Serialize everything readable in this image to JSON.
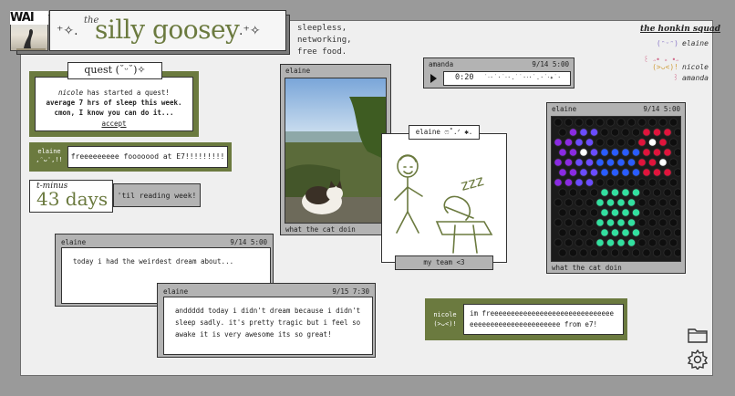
{
  "header": {
    "thumb_text": "WAI",
    "title_prefix": "the",
    "title": "silly goosey",
    "deco_left": "⁺✧.",
    "deco_right": ".⁺✧",
    "tagline": "sleepless,\nnetworking,\nfree food."
  },
  "squad": {
    "title": "the honkin squad",
    "members": [
      {
        "face": "(ᵔᵕᵔ)",
        "name": "elaine",
        "color": "#8a78c8"
      },
      {
        "face": "꒰ ˶• ༝ •˶꒱",
        "name": "amanda",
        "color": "#d06a8a"
      },
      {
        "face": "(>ᴗ<)!",
        "name": "nicole",
        "color": "#d0a040"
      }
    ]
  },
  "quest": {
    "label": "quest (˘ᵕ˘)✧",
    "user": "nicole",
    "line1": " has started a quest!",
    "line2": "average 7 hrs of sleep this week.",
    "line3": "cmon, I know you can do it...",
    "accept": "accept"
  },
  "elaine_chat": {
    "name": "elaine",
    "face": ",ᵔᴗᵔ,!!",
    "message": "freeeeeeeee fooooood at E7!!!!!!!!!"
  },
  "countdown": {
    "label": "t-minus",
    "value": "43 days",
    "side": "'til reading week!"
  },
  "post1": {
    "author": "elaine",
    "time": "9/14 5:00",
    "body": "today i had the weirdest dream about..."
  },
  "post2": {
    "author": "elaine",
    "time": "9/15 7:30",
    "body": "anddddd today i didn't dream because i didn't sleep sadly. it's pretty tragic but i feel so awake it is very awesome its so great!"
  },
  "photo1": {
    "author": "elaine",
    "caption": "what the cat doin"
  },
  "audio": {
    "author": "amanda",
    "time": "9/14 5:00",
    "duration": "0:20",
    "wave": "˙‧·˙·˙‧·.˙˙·‧·˙.·˙‧✦˙·"
  },
  "drawing": {
    "label": "elaine ෆ˚.ᐟ ✱.",
    "caption": "my team <3",
    "zzz": "zzz"
  },
  "photo2": {
    "author": "elaine",
    "time": "9/14 5:00",
    "caption": "what the cat doin"
  },
  "nicole_chat": {
    "name": "nicole",
    "face": "(>ᴗ<)!",
    "message": "im freeeeeeeeeeeeeeeeeeeeeeeeeeeeeeeeeeeeeeeeeeeeeeeeeeee from e7!"
  },
  "colors": {
    "green": "#6b7a3f",
    "grey": "#b3b3b3",
    "board": "#efefef"
  }
}
